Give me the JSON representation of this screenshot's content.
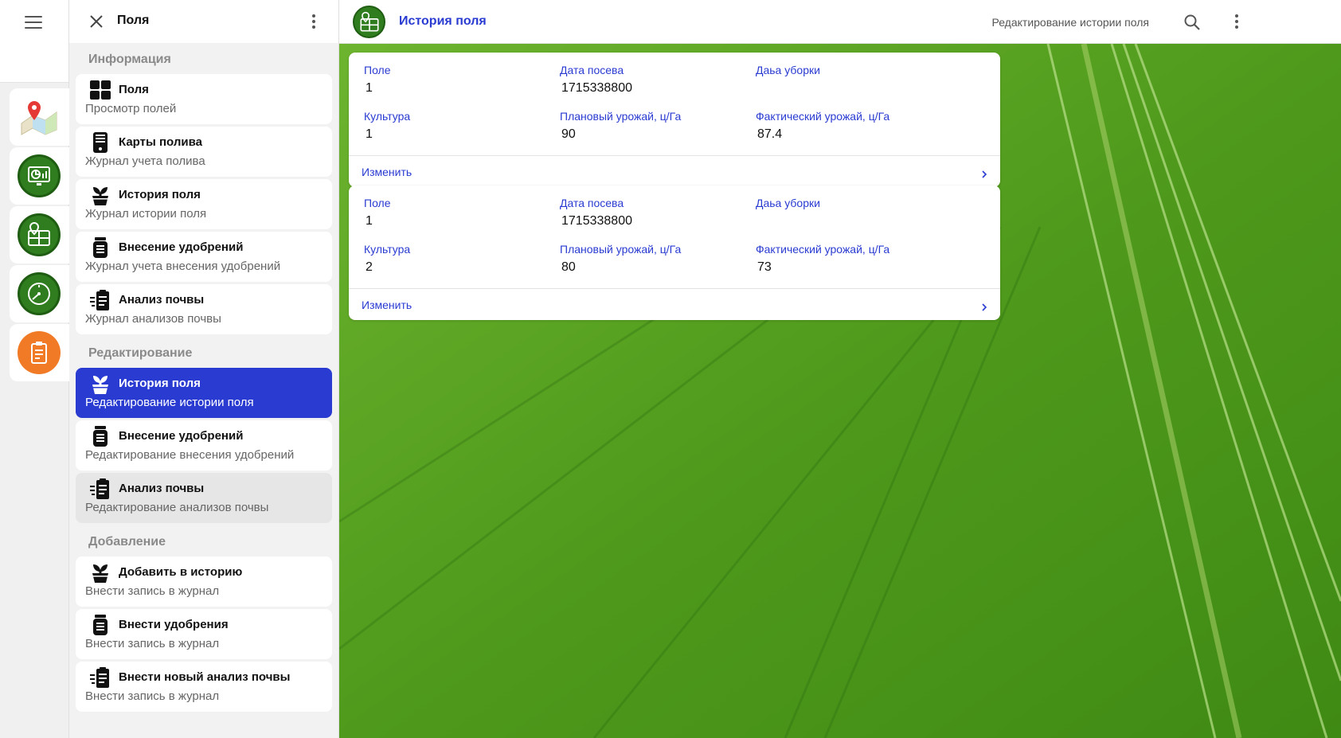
{
  "drawer": {
    "title": "Поля",
    "sections": [
      {
        "label": "Информация",
        "items": [
          {
            "title": "Поля",
            "subtitle": "Просмотр полей",
            "icon": "grid-icon"
          },
          {
            "title": "Карты полива",
            "subtitle": "Журнал учета полива",
            "icon": "phone-icon"
          },
          {
            "title": "История поля",
            "subtitle": "Журнал истории поля",
            "icon": "plant-pot-icon"
          },
          {
            "title": "Внесение удобрений",
            "subtitle": "Журнал учета внесения удобрений",
            "icon": "fertilizer-jar-icon"
          },
          {
            "title": "Анализ почвы",
            "subtitle": "Журнал анализов почвы",
            "icon": "clipboard-analysis-icon"
          }
        ]
      },
      {
        "label": "Редактирование",
        "items": [
          {
            "title": "История поля",
            "subtitle": "Редактирование истории поля",
            "icon": "plant-pot-icon",
            "state": "active"
          },
          {
            "title": "Внесение удобрений",
            "subtitle": "Редактирование внесения удобрений",
            "icon": "fertilizer-jar-icon"
          },
          {
            "title": "Анализ почвы",
            "subtitle": "Редактирование анализов почвы",
            "icon": "clipboard-analysis-icon",
            "state": "pressed"
          }
        ]
      },
      {
        "label": "Добавление",
        "items": [
          {
            "title": "Добавить в историю",
            "subtitle": "Внести запись в журнал",
            "icon": "plant-pot-icon"
          },
          {
            "title": "Внести удобрения",
            "subtitle": "Внести запись в журнал",
            "icon": "fertilizer-jar-icon"
          },
          {
            "title": "Внести новый анализ почвы",
            "subtitle": "Внести запись в журнал",
            "icon": "clipboard-analysis-icon"
          }
        ]
      }
    ]
  },
  "rail": {
    "apps": [
      {
        "icon": "map-pin-icon"
      },
      {
        "icon": "monitor-chart-icon"
      },
      {
        "icon": "field-map-icon"
      },
      {
        "icon": "gauge-icon"
      },
      {
        "icon": "clipboard-icon"
      }
    ]
  },
  "topbar": {
    "title": "История поля",
    "subtitle": "Редактирование истории поля",
    "logo_icon": "field-map-icon"
  },
  "labels": {
    "field": "Поле",
    "sow_date": "Дата посева",
    "harvest_date": "Даьа уборки",
    "crop": "Культура",
    "planned_yield": "Плановый урожай, ц/Га",
    "actual_yield": "Фактический урожай, ц/Га",
    "edit": "Изменить"
  },
  "records": [
    {
      "field": "1",
      "sow_date": "1715338800",
      "harvest_date": "",
      "crop": "1",
      "planned_yield": "90",
      "actual_yield": "87.4"
    },
    {
      "field": "1",
      "sow_date": "1715338800",
      "harvest_date": "",
      "crop": "2",
      "planned_yield": "80",
      "actual_yield": "73"
    }
  ],
  "colors": {
    "accent": "#2a3bd1",
    "app_green": "#2f7d1e",
    "app_orange": "#f07a25",
    "field_green": "#4f9a1c"
  }
}
